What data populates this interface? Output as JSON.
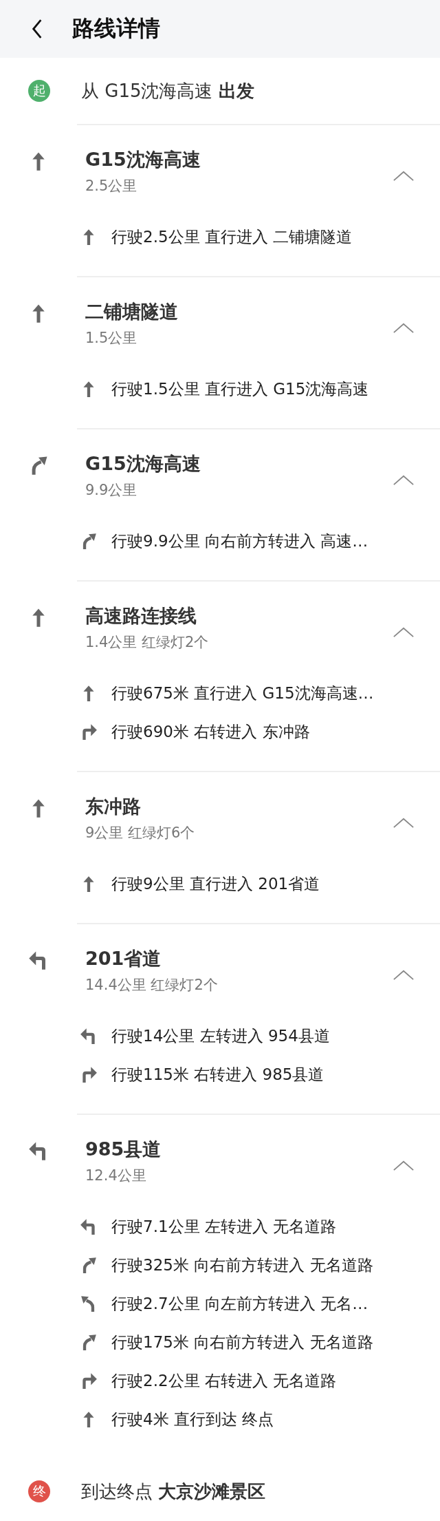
{
  "header": {
    "title": "路线详情"
  },
  "start": {
    "kind": "start",
    "badge": "起",
    "text": "从 G15沈海高速 **出发**"
  },
  "sections": [
    {
      "kind": "straight",
      "road": "G15沈海高速",
      "summary": "2.5公里",
      "expanded": true,
      "steps": [
        {
          "kind": "straight",
          "text": "行驶2.5公里 直行进入 二铺塘隧道"
        }
      ]
    },
    {
      "kind": "straight",
      "road": "二铺塘隧道",
      "summary": "1.5公里",
      "expanded": true,
      "steps": [
        {
          "kind": "straight",
          "text": "行驶1.5公里 直行进入 G15沈海高速"
        }
      ]
    },
    {
      "kind": "bearright",
      "road": "G15沈海高速",
      "summary": "9.9公里",
      "expanded": true,
      "steps": [
        {
          "kind": "bearright",
          "text": "行驶9.9公里 向右前方转进入 高速…"
        }
      ]
    },
    {
      "kind": "straight",
      "road": "高速路连接线",
      "summary": "1.4公里 红绿灯2个",
      "expanded": true,
      "steps": [
        {
          "kind": "straight",
          "text": "行驶675米 直行进入 G15沈海高速…"
        },
        {
          "kind": "right",
          "text": "行驶690米 右转进入 东冲路"
        }
      ]
    },
    {
      "kind": "straight",
      "road": "东冲路",
      "summary": "9公里 红绿灯6个",
      "expanded": true,
      "steps": [
        {
          "kind": "straight",
          "text": "行驶9公里 直行进入 201省道"
        }
      ]
    },
    {
      "kind": "left",
      "road": "201省道",
      "summary": "14.4公里 红绿灯2个",
      "expanded": true,
      "steps": [
        {
          "kind": "left",
          "text": "行驶14公里 左转进入 954县道"
        },
        {
          "kind": "right",
          "text": "行驶115米 右转进入 985县道"
        }
      ]
    },
    {
      "kind": "left",
      "road": "985县道",
      "summary": "12.4公里",
      "expanded": true,
      "steps": [
        {
          "kind": "left",
          "text": "行驶7.1公里 左转进入 无名道路"
        },
        {
          "kind": "bearright",
          "text": "行驶325米 向右前方转进入 无名道路"
        },
        {
          "kind": "bearleft",
          "text": "行驶2.7公里 向左前方转进入 无名…"
        },
        {
          "kind": "bearright",
          "text": "行驶175米 向右前方转进入 无名道路"
        },
        {
          "kind": "right",
          "text": "行驶2.2公里 右转进入 无名道路"
        },
        {
          "kind": "straight",
          "text": "行驶4米 直行到达 终点"
        }
      ]
    }
  ],
  "end": {
    "kind": "end",
    "badge": "终",
    "text": "到达终点 **大京沙滩景区**"
  }
}
